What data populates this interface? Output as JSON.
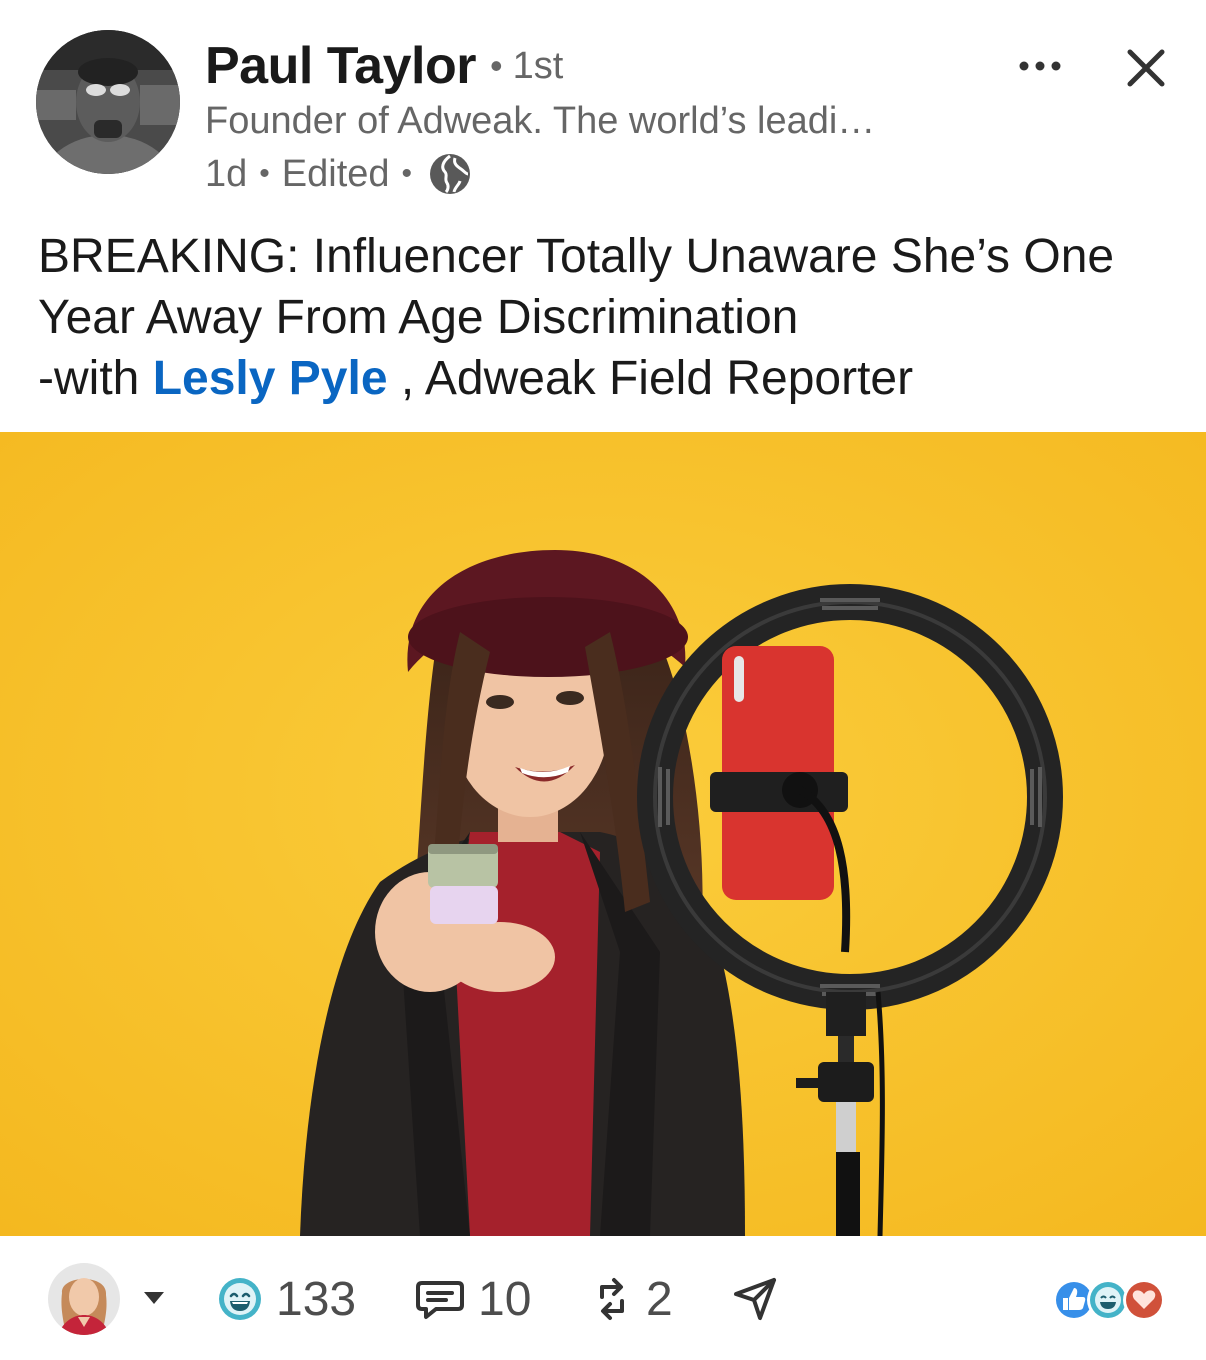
{
  "post": {
    "author": {
      "name": "Paul Taylor",
      "separator": "•",
      "connection_degree": "1st",
      "headline": "Founder of Adweak. The world’s leadi…",
      "time": "1d",
      "edited": "Edited",
      "visibility_icon": "globe-icon"
    },
    "header_actions": {
      "more_icon": "ellipsis-icon",
      "close_icon": "close-icon"
    },
    "text": {
      "line1": "BREAKING: Influencer Totally Unaware She’s One",
      "line2": "Year Away From Age Discrimination",
      "line3_prefix": "-with ",
      "mention": "Lesly Pyle",
      "line3_suffix": " , Adweak Field Reporter"
    },
    "image": {
      "subject": "girl-influencer-with-ring-light-photo"
    }
  },
  "footer": {
    "actor_avatar_icon": "user-avatar",
    "caret_icon": "caret-down-icon",
    "reaction_icon": "funny-reaction-icon",
    "reaction_count": "133",
    "comment_icon": "comment-icon",
    "comment_count": "10",
    "repost_icon": "repost-icon",
    "repost_count": "2",
    "send_icon": "send-icon",
    "reaction_summary_icons": [
      "like-reaction-icon",
      "funny-reaction-icon",
      "love-reaction-icon"
    ]
  },
  "colors": {
    "link_blue": "#0a66c2",
    "image_background": "#f7c22f",
    "funny_teal": "#44b3c8",
    "love_red": "#d0513a"
  }
}
